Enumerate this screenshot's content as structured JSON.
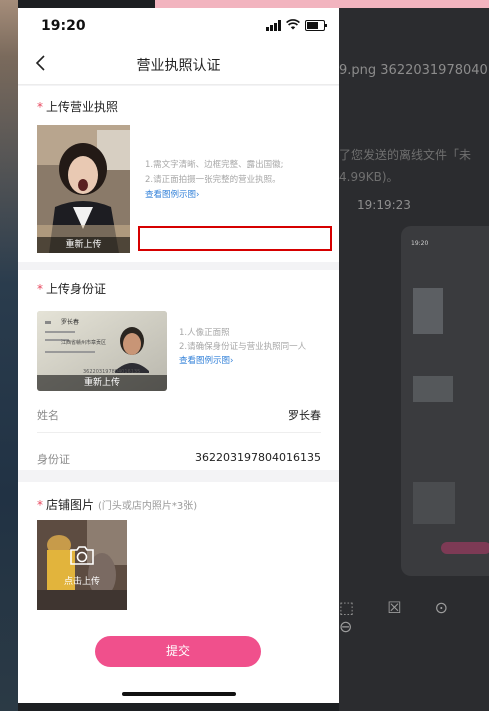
{
  "status_bar": {
    "time": "19:20"
  },
  "nav": {
    "title": "营业执照认证"
  },
  "business_license": {
    "title": "上传营业执照",
    "reupload_label": "重新上传",
    "tips": [
      "1.需文字清晰、边框完整、露出国徽;",
      "2.请正面拍摄一张完整的营业执照。"
    ],
    "example_link": "查看图例示图›"
  },
  "id_card": {
    "title": "上传身份证",
    "reupload_label": "重新上传",
    "tips": [
      "1.人像正面照",
      "2.请确保身份证与营业执照同一人"
    ],
    "example_link": "查看图例示图›",
    "card_name": "罗长春",
    "card_address": "江西省赣州市章贡区",
    "card_number": "362203197804016135"
  },
  "fields": [
    {
      "label": "姓名",
      "value": "罗长春"
    },
    {
      "label": "身份证",
      "value": "362203197804016135"
    }
  ],
  "store_photos": {
    "title": "店铺图片",
    "hint": "(门头或店内照片*3张)",
    "upload_label": "点击上传"
  },
  "submit_label": "提交",
  "background": {
    "file_name": "9.png  3622031978040",
    "text_line1": "了您发送的离线文件「未",
    "text_line2": "4.99KB)。",
    "time": "19:19:23",
    "mini_time": "19:20"
  },
  "colors": {
    "accent": "#f0508c",
    "required_star": "#e8475e",
    "link": "#2f7fd8",
    "highlight_box": "#d60000"
  }
}
